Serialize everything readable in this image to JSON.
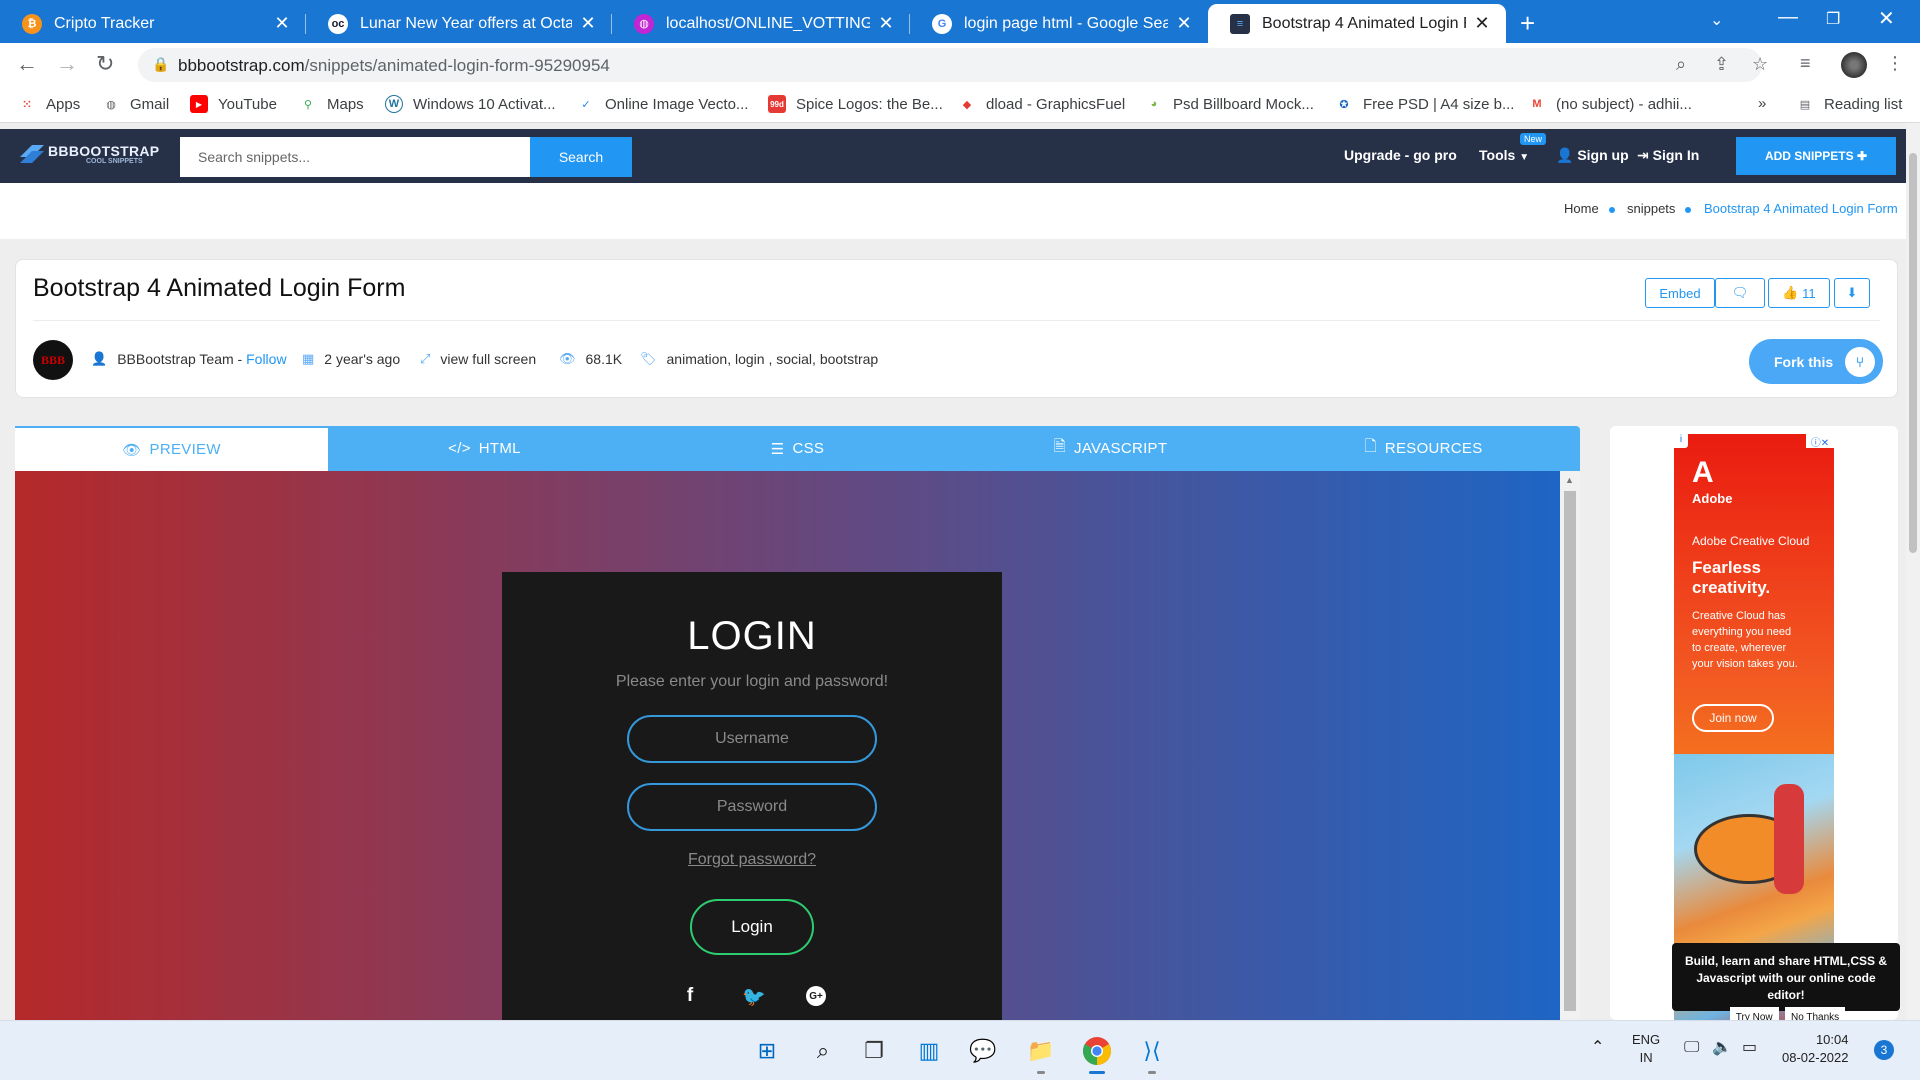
{
  "browser": {
    "tabs": [
      {
        "title": "Cripto Tracker",
        "icon": "bitcoin-icon",
        "color": "#f7931a"
      },
      {
        "title": "Lunar New Year offers at OctaFX",
        "icon": "octafx-icon",
        "color": "#1a1a2e"
      },
      {
        "title": "localhost/ONLINE_VOTTING/",
        "icon": "globe-icon",
        "color": "#c026d3"
      },
      {
        "title": "login page html - Google Search",
        "icon": "google-icon",
        "color": "#ffffff"
      },
      {
        "title": "Bootstrap 4 Animated Login Form",
        "icon": "bbbootstrap-icon",
        "color": "#263147",
        "active": true
      }
    ],
    "url_domain": "bbbootstrap.com",
    "url_path": "/snippets/animated-login-form-95290954",
    "bookmarks": [
      {
        "label": "Apps",
        "icon": "apps-grid-icon"
      },
      {
        "label": "Gmail",
        "icon": "globe-icon"
      },
      {
        "label": "YouTube",
        "icon": "youtube-icon"
      },
      {
        "label": "Maps",
        "icon": "maps-pin-icon"
      },
      {
        "label": "Windows 10 Activat...",
        "icon": "wordpress-icon"
      },
      {
        "label": "Online Image Vecto...",
        "icon": "vector-icon"
      },
      {
        "label": "Spice Logos: the Be...",
        "icon": "spice-icon"
      },
      {
        "label": "dload - GraphicsFuel",
        "icon": "graphicsfuel-icon"
      },
      {
        "label": "Psd Billboard Mock...",
        "icon": "circle-arrow-icon"
      },
      {
        "label": "Free PSD | A4 size b...",
        "icon": "freepik-icon"
      },
      {
        "label": "(no subject) - adhii...",
        "icon": "gmail-icon"
      }
    ],
    "reading_list": "Reading list",
    "overflow": "»"
  },
  "site": {
    "logo_text": "BBBOOTSTRAP",
    "logo_sub": "COOL SNIPPETS",
    "search_placeholder": "Search snippets...",
    "search_button": "Search",
    "nav": {
      "upgrade": "Upgrade - go pro",
      "tools": "Tools",
      "new_badge": "New",
      "signup": "Sign up",
      "signin": "Sign In",
      "add_snippets": "ADD SNIPPETS"
    },
    "breadcrumb": [
      "Home",
      "snippets",
      "Bootstrap 4 Animated Login Form"
    ]
  },
  "snippet": {
    "title": "Bootstrap 4 Animated Login Form",
    "embed": "Embed",
    "likes": "11",
    "author": "BBBootstrap Team - ",
    "follow": "Follow",
    "avatar_text": "BBB",
    "age": "2 year's ago",
    "fullscreen": "view full screen",
    "views": "68.1K",
    "tags": "animation, login , social, bootstrap",
    "fork": "Fork this"
  },
  "code_tabs": [
    {
      "label": "PREVIEW",
      "icon": "eye-icon",
      "active": true
    },
    {
      "label": "HTML",
      "icon": "code-icon"
    },
    {
      "label": "CSS",
      "icon": "css3-icon"
    },
    {
      "label": "JAVASCRIPT",
      "icon": "js-file-icon"
    },
    {
      "label": "RESOURCES",
      "icon": "file-icon"
    }
  ],
  "login_preview": {
    "heading": "LOGIN",
    "subtitle": "Please enter your login and password!",
    "username_placeholder": "Username",
    "password_placeholder": "Password",
    "forgot": "Forgot password?",
    "button": "Login",
    "gradient_colors": [
      "#b5292a",
      "#6c4577",
      "#1e65c4"
    ]
  },
  "ad": {
    "logo": "A",
    "brand": "Adobe",
    "product": "Adobe Creative Cloud",
    "headline": "Fearless creativity.",
    "body": "Creative Cloud has everything you need to create, wherever your vision takes you.",
    "cta": "Join now",
    "choices": "ⓘ✕"
  },
  "tooltip": {
    "text": "Build, learn and share HTML,CSS & Javascript with our online code editor!",
    "try": "Try Now",
    "no": "No Thanks"
  },
  "taskbar": {
    "lang1": "ENG",
    "lang2": "IN",
    "time": "10:04",
    "date": "08-02-2022",
    "notifications": "3"
  }
}
